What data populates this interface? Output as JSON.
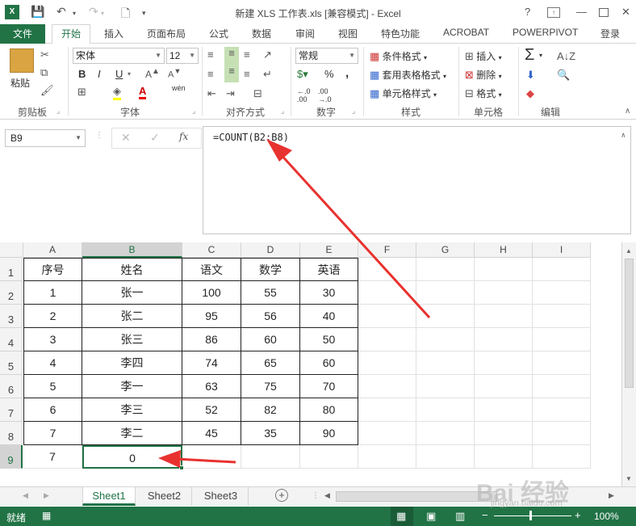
{
  "window": {
    "title": "新建 XLS 工作表.xls [兼容模式] - Excel",
    "help": "?",
    "minimize": "—",
    "close": "✕"
  },
  "tabs": {
    "file": "文件",
    "items": [
      "开始",
      "插入",
      "页面布局",
      "公式",
      "数据",
      "审阅",
      "视图",
      "特色功能",
      "ACROBAT",
      "POWERPIVOT"
    ],
    "login": "登录"
  },
  "ribbon": {
    "paste": "粘贴",
    "font_name": "宋体",
    "font_size": "12",
    "bold": "B",
    "italic": "I",
    "underline": "U",
    "number_format": "常规",
    "percent": "%",
    "comma": ",",
    "cond_format": "条件格式",
    "table_format": "套用表格格式",
    "cell_style": "单元格样式",
    "insert": "插入",
    "delete": "删除",
    "format": "格式",
    "wen": "wén",
    "groups": [
      "剪贴板",
      "字体",
      "对齐方式",
      "数字",
      "样式",
      "单元格",
      "编辑"
    ]
  },
  "formula_bar": {
    "name_box": "B9",
    "fx": "fx",
    "formula": "=COUNT(B2:B8)"
  },
  "grid": {
    "columns": [
      "A",
      "B",
      "C",
      "D",
      "E",
      "F",
      "G",
      "H",
      "I"
    ],
    "rows": [
      "1",
      "2",
      "3",
      "4",
      "5",
      "6",
      "7",
      "8",
      "9"
    ],
    "header": [
      "序号",
      "姓名",
      "语文",
      "数学",
      "英语"
    ],
    "data": [
      [
        "1",
        "张一",
        "100",
        "55",
        "30"
      ],
      [
        "2",
        "张二",
        "95",
        "56",
        "40"
      ],
      [
        "3",
        "张三",
        "86",
        "60",
        "50"
      ],
      [
        "4",
        "李四",
        "74",
        "65",
        "60"
      ],
      [
        "5",
        "李一",
        "63",
        "75",
        "70"
      ],
      [
        "6",
        "李三",
        "52",
        "82",
        "80"
      ],
      [
        "7",
        "李二",
        "45",
        "35",
        "90"
      ]
    ],
    "row9": [
      "7",
      "0"
    ]
  },
  "sheets": [
    "Sheet1",
    "Sheet2",
    "Sheet3"
  ],
  "status": {
    "ready": "就绪",
    "zoom": "100%"
  },
  "watermark": {
    "main": "Bai 经验",
    "sub": "jingyan.baidu.com"
  },
  "colors": {
    "excel_green": "#217346",
    "arrow_red": "#e8322f"
  }
}
